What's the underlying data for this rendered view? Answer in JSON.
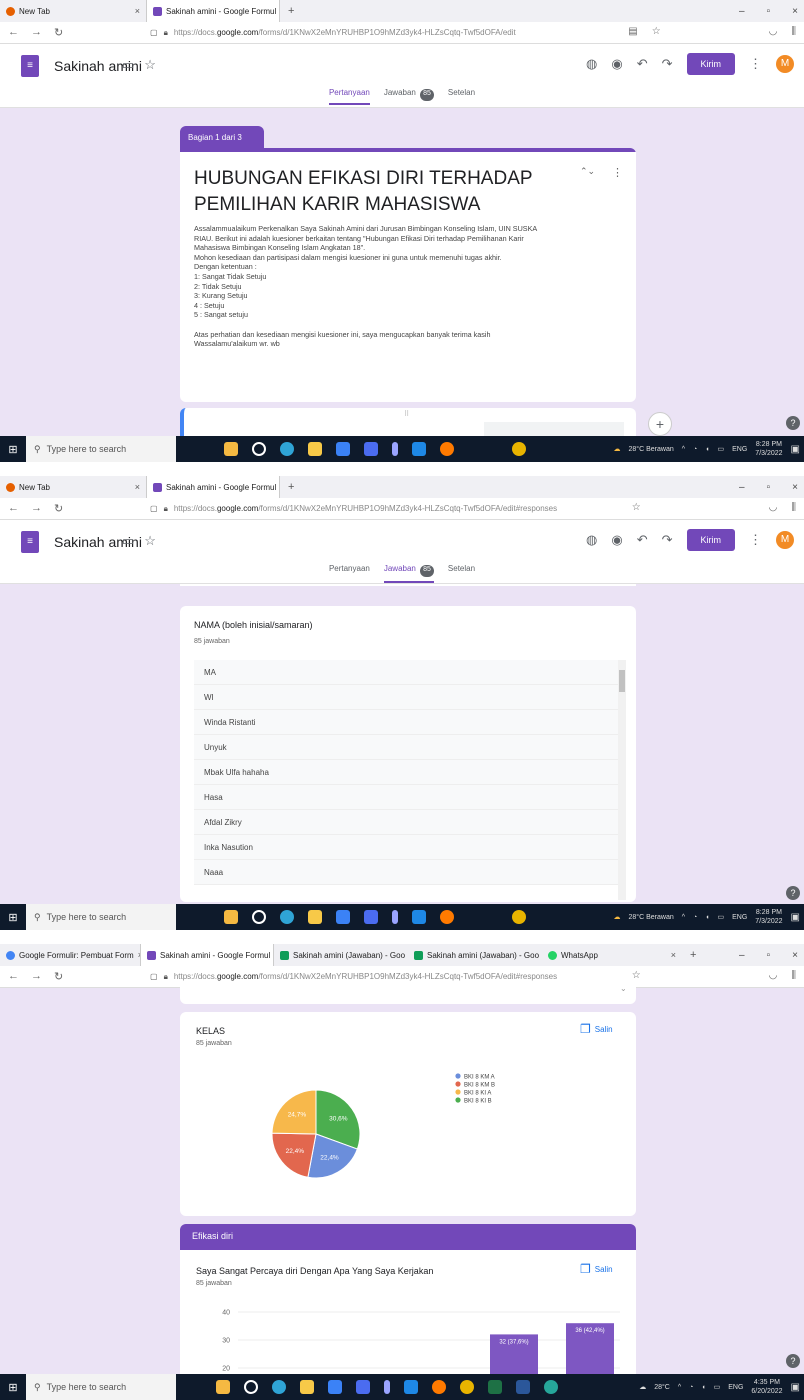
{
  "shot1": {
    "tabs": [
      {
        "label": "New Tab"
      },
      {
        "label": "Sakinah amini - Google Formul"
      }
    ],
    "url": {
      "prefix": "https://docs.",
      "domain": "google.com",
      "path": "/forms/d/1KNwX2eMnYRUHBP1O9hMZd3yk4-HLZsCqtq-Twf5dOFA/edit"
    },
    "form_title": "Sakinah amini",
    "send_label": "Kirim",
    "avatar_letter": "M",
    "tab_questions": "Pertanyaan",
    "tab_responses": "Jawaban",
    "response_count": "85",
    "tab_settings": "Setelan",
    "section_label": "Bagian 1 dari 3",
    "heading": "HUBUNGAN EFIKASI DIRI TERHADAP PEMILIHAN KARIR MAHASISWA",
    "description": [
      "Assalammualaikum Perkenalkan Saya Sakinah Amini dari Jurusan Bimbingan Konseling Islam, UIN SUSKA",
      "RIAU. Berikut ini adalah kuesioner berkaitan tentang \"Hubungan Efikasi Diri terhadap Pemilihanan Karir",
      "Mahasiswa Bimbingan Konseling Islam Angkatan 18\".",
      "Mohon kesediaan dan partisipasi dalam mengisi kuesioner ini guna untuk memenuhi tugas akhir.",
      "Dengan ketentuan :",
      "1: Sangat Tidak Setuju",
      "2: Tidak Setuju",
      "3: Kurang Setuju",
      "4 : Setuju",
      "5 : Sangat setuju",
      "",
      "Atas perhatian dan kesediaan mengisi kuesioner ini, saya mengucapkan banyak terima kasih",
      "Wassalamu'alaikum wr. wb"
    ],
    "taskbar": {
      "search": "Type here to search",
      "weather": "28°C  Berawan",
      "lang": "ENG",
      "time": "8:28 PM",
      "date": "7/3/2022"
    }
  },
  "shot2": {
    "tabs": [
      {
        "label": "New Tab"
      },
      {
        "label": "Sakinah amini - Google Formul"
      }
    ],
    "url": {
      "prefix": "https://docs.",
      "domain": "google.com",
      "path": "/forms/d/1KNwX2eMnYRUHBP1O9hMZd3yk4-HLZsCqtq-Twf5dOFA/edit#responses"
    },
    "form_title": "Sakinah amini",
    "send_label": "Kirim",
    "avatar_letter": "M",
    "tab_questions": "Pertanyaan",
    "tab_responses": "Jawaban",
    "response_count": "85",
    "tab_settings": "Setelan",
    "question": "NAMA (boleh inisial/samaran)",
    "answers_count": "85 jawaban",
    "answers": [
      "MA",
      "WI",
      "Winda Ristanti",
      "Unyuk",
      "Mbak Ulfa hahaha",
      "Hasa",
      "Afdal Zikry",
      "Inka Nasution",
      "Naaa"
    ],
    "taskbar": {
      "search": "Type here to search",
      "weather": "28°C  Berawan",
      "lang": "ENG",
      "time": "8:28 PM",
      "date": "7/3/2022"
    }
  },
  "shot3": {
    "tabs": [
      {
        "label": "Google Formulir: Pembuat Form"
      },
      {
        "label": "Sakinah amini - Google Formul"
      },
      {
        "label": "Sakinah amini (Jawaban) - Goo"
      },
      {
        "label": "Sakinah amini (Jawaban) - Goo"
      },
      {
        "label": "WhatsApp"
      }
    ],
    "url": {
      "prefix": "https://docs.",
      "domain": "google.com",
      "path": "/forms/d/1KNwX2eMnYRUHBP1O9hMZd3yk4-HLZsCqtq-Twf5dOFA/edit#responses"
    },
    "kelas_title": "KELAS",
    "kelas_count": "85 jawaban",
    "copy_label": "Salin",
    "section2": "Efikasi diri",
    "q2_title": "Saya Sangat Percaya diri Dengan Apa Yang Saya Kerjakan",
    "q2_count": "85 jawaban",
    "taskbar": {
      "search": "Type here to search",
      "weather": "28°C",
      "lang": "ENG",
      "time": "4:35 PM",
      "date": "6/20/2022"
    }
  },
  "chart_data": [
    {
      "type": "pie",
      "title": "KELAS",
      "categories": [
        "BKI 8 KM A",
        "BKI 8 KM B",
        "BKI 8 KI A",
        "BKI 8 KI B"
      ],
      "values": [
        22.4,
        22.4,
        24.7,
        30.6
      ],
      "labels": [
        "22,4%",
        "22,4%",
        "24,7%",
        "30,6%"
      ],
      "colors": [
        "#6b8edb",
        "#e2674e",
        "#f7b84b",
        "#4bae4f"
      ],
      "legend": "right"
    },
    {
      "type": "bar",
      "title": "Saya Sangat Percaya diri Dengan Apa Yang Saya Kerjakan",
      "ylim": [
        0,
        40
      ],
      "yticks": [
        20,
        30,
        40
      ],
      "visible_bars": [
        {
          "value": 32,
          "label": "32 (37,6%)"
        },
        {
          "value": 36,
          "label": "36 (42,4%)"
        }
      ],
      "color": "#7e57c2"
    }
  ]
}
